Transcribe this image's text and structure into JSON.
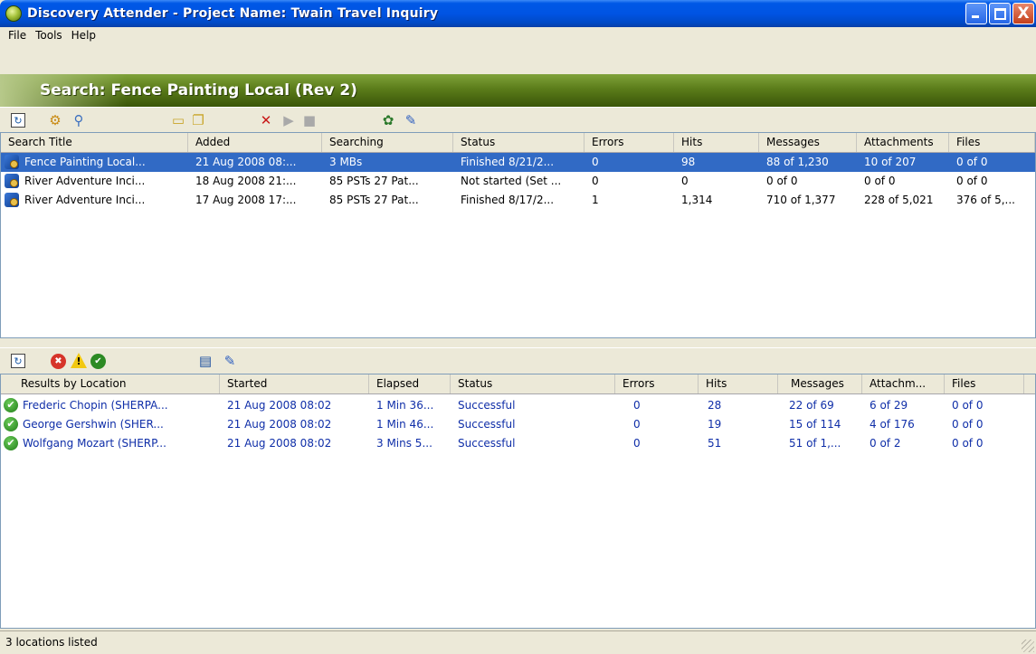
{
  "window": {
    "title": "Discovery Attender - Project Name:  Twain Travel Inquiry",
    "buttons": {
      "minimize": "_",
      "maximize": "□",
      "close": "X"
    }
  },
  "menu": [
    "File",
    "Tools",
    "Help"
  ],
  "banner": {
    "title": "Search:  Fence Painting Local (Rev 2)"
  },
  "top_toolbar": {
    "icons": [
      "refresh-icon",
      "new-search-icon",
      "edit-search-icon",
      "folder-icon",
      "copy-icon",
      "delete-icon",
      "play-icon",
      "stop-icon",
      "run-all-icon",
      "wand-icon"
    ],
    "glyphs": {
      "refresh": "↻",
      "delete": "✕",
      "play": "▶",
      "stop": "■",
      "run": "✿",
      "wand": "✎"
    }
  },
  "searches": {
    "columns": [
      "Search Title",
      "Added",
      "Searching",
      "Status",
      "Errors",
      "Hits",
      "Messages",
      "Attachments",
      "Files"
    ],
    "rows": [
      [
        "Fence Painting Local...",
        "21 Aug 2008 08:...",
        "3 MBs",
        "Finished 8/21/2...",
        "0",
        "98",
        "88 of 1,230",
        "10 of 207",
        "0 of 0"
      ],
      [
        "River Adventure Inci...",
        "18 Aug 2008 21:...",
        "85 PSTs 27 Pat...",
        "Not started (Set ...",
        "0",
        "0",
        "0 of 0",
        "0 of 0",
        "0 of 0"
      ],
      [
        "River Adventure Inci...",
        "17 Aug 2008 17:...",
        "85 PSTs 27 Pat...",
        "Finished 8/17/2...",
        "1",
        "1,314",
        "710 of 1,377",
        "228 of 5,021",
        "376 of 5,..."
      ]
    ],
    "selected_row": 0
  },
  "bottom_toolbar": {
    "icons": [
      "refresh-icon",
      "error-filter-icon",
      "warning-filter-icon",
      "success-filter-icon",
      "report-icon",
      "wand-icon"
    ],
    "glyphs": {
      "refresh": "↻",
      "error": "✖",
      "warning": "!",
      "success": "✔",
      "report": "▤",
      "wand": "✎"
    }
  },
  "locations": {
    "columns": [
      "Results by Location",
      "Started",
      "Elapsed",
      "Status",
      "Errors",
      "Hits",
      "Messages",
      "Attachm...",
      "Files"
    ],
    "rows": [
      [
        "Frederic Chopin (SHERPA...",
        "21 Aug 2008 08:02",
        "1 Min 36...",
        "Successful",
        "0",
        "28",
        "22 of 69",
        "6 of 29",
        "0 of 0"
      ],
      [
        "George Gershwin (SHER...",
        "21 Aug 2008 08:02",
        "1 Min 46...",
        "Successful",
        "0",
        "19",
        "15 of 114",
        "4 of 176",
        "0 of 0"
      ],
      [
        "Wolfgang Mozart (SHERP...",
        "21 Aug 2008 08:02",
        "3 Mins 5...",
        "Successful",
        "0",
        "51",
        "51 of 1,...",
        "0 of 2",
        "0 of 0"
      ]
    ],
    "row_glyph": "✔"
  },
  "status": {
    "text": "3 locations listed"
  }
}
